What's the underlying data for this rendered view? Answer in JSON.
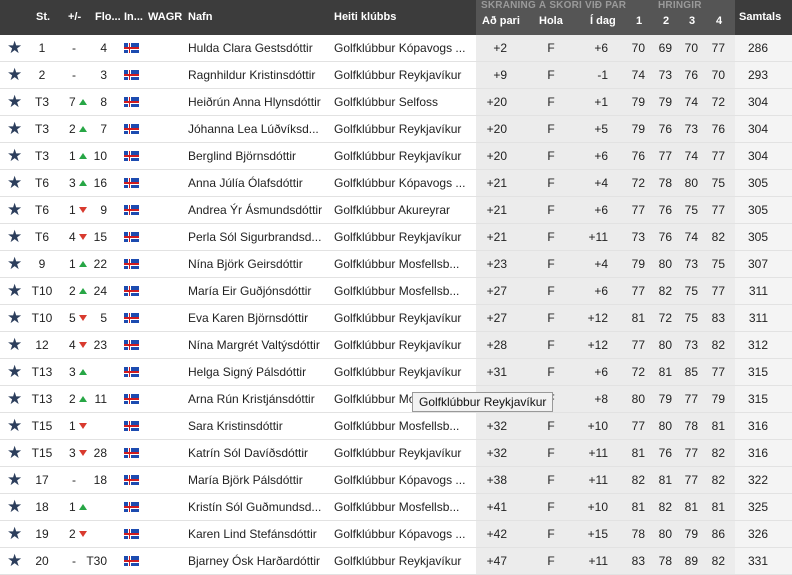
{
  "header": {
    "st": "St.",
    "plusminus": "+/-",
    "flo": "Flo...",
    "in": "In...",
    "wagr": "WAGR",
    "name": "Nafn",
    "club": "Heiti klúbbs",
    "scoring_group": "SKRÁNING Á SKORI VIÐ PAR",
    "par": "Að pari",
    "hole": "Hola",
    "today": "Í dag",
    "rounds_group": "HRINGIR",
    "r1": "1",
    "r2": "2",
    "r3": "3",
    "r4": "4",
    "total": "Samtals"
  },
  "rows": [
    {
      "st": "1",
      "pm": "-",
      "dir": "",
      "flo": "4",
      "name": "Hulda Clara Gestsdóttir",
      "club": "Golfklúbbur Kópavogs ...",
      "par": "+2",
      "hole": "F",
      "today": "+6",
      "r1": "70",
      "r2": "69",
      "r3": "70",
      "r4": "77",
      "total": "286"
    },
    {
      "st": "2",
      "pm": "-",
      "dir": "",
      "flo": "3",
      "name": "Ragnhildur Kristinsdóttir",
      "club": "Golfklúbbur Reykjavíkur",
      "par": "+9",
      "hole": "F",
      "today": "-1",
      "r1": "74",
      "r2": "73",
      "r3": "76",
      "r4": "70",
      "total": "293"
    },
    {
      "st": "T3",
      "pm": "7",
      "dir": "up",
      "flo": "8",
      "name": "Heiðrún Anna Hlynsdóttir",
      "club": "Golfklúbbur Selfoss",
      "par": "+20",
      "hole": "F",
      "today": "+1",
      "r1": "79",
      "r2": "79",
      "r3": "74",
      "r4": "72",
      "total": "304"
    },
    {
      "st": "T3",
      "pm": "2",
      "dir": "up",
      "flo": "7",
      "name": "Jóhanna Lea Lúðvíksd...",
      "club": "Golfklúbbur Reykjavíkur",
      "par": "+20",
      "hole": "F",
      "today": "+5",
      "r1": "79",
      "r2": "76",
      "r3": "73",
      "r4": "76",
      "total": "304"
    },
    {
      "st": "T3",
      "pm": "1",
      "dir": "up",
      "flo": "10",
      "name": "Berglind Björnsdóttir",
      "club": "Golfklúbbur Reykjavíkur",
      "par": "+20",
      "hole": "F",
      "today": "+6",
      "r1": "76",
      "r2": "77",
      "r3": "74",
      "r4": "77",
      "total": "304"
    },
    {
      "st": "T6",
      "pm": "3",
      "dir": "up",
      "flo": "16",
      "name": "Anna Júlía Ólafsdóttir",
      "club": "Golfklúbbur Kópavogs ...",
      "par": "+21",
      "hole": "F",
      "today": "+4",
      "r1": "72",
      "r2": "78",
      "r3": "80",
      "r4": "75",
      "total": "305"
    },
    {
      "st": "T6",
      "pm": "1",
      "dir": "down",
      "flo": "9",
      "name": "Andrea Ýr Ásmundsdóttir",
      "club": "Golfklúbbur Akureyrar",
      "par": "+21",
      "hole": "F",
      "today": "+6",
      "r1": "77",
      "r2": "76",
      "r3": "75",
      "r4": "77",
      "total": "305"
    },
    {
      "st": "T6",
      "pm": "4",
      "dir": "down",
      "flo": "15",
      "name": "Perla Sól Sigurbrandsd...",
      "club": "Golfklúbbur Reykjavíkur",
      "par": "+21",
      "hole": "F",
      "today": "+11",
      "r1": "73",
      "r2": "76",
      "r3": "74",
      "r4": "82",
      "total": "305"
    },
    {
      "st": "9",
      "pm": "1",
      "dir": "up",
      "flo": "22",
      "name": "Nína Björk Geirsdóttir",
      "club": "Golfklúbbur Mosfellsb...",
      "par": "+23",
      "hole": "F",
      "today": "+4",
      "r1": "79",
      "r2": "80",
      "r3": "73",
      "r4": "75",
      "total": "307"
    },
    {
      "st": "T10",
      "pm": "2",
      "dir": "up",
      "flo": "24",
      "name": "María Eir Guðjónsdóttir",
      "club": "Golfklúbbur Mosfellsb...",
      "par": "+27",
      "hole": "F",
      "today": "+6",
      "r1": "77",
      "r2": "82",
      "r3": "75",
      "r4": "77",
      "total": "311"
    },
    {
      "st": "T10",
      "pm": "5",
      "dir": "down",
      "flo": "5",
      "name": "Eva Karen Björnsdóttir",
      "club": "Golfklúbbur Reykjavíkur",
      "par": "+27",
      "hole": "F",
      "today": "+12",
      "r1": "81",
      "r2": "72",
      "r3": "75",
      "r4": "83",
      "total": "311"
    },
    {
      "st": "12",
      "pm": "4",
      "dir": "down",
      "flo": "23",
      "name": "Nína Margrét Valtýsdóttir",
      "club": "Golfklúbbur Reykjavíkur",
      "par": "+28",
      "hole": "F",
      "today": "+12",
      "r1": "77",
      "r2": "80",
      "r3": "73",
      "r4": "82",
      "total": "312"
    },
    {
      "st": "T13",
      "pm": "3",
      "dir": "up",
      "flo": "",
      "name": "Helga Signý Pálsdóttir",
      "club": "Golfklúbbur Reykjavíkur",
      "par": "+31",
      "hole": "F",
      "today": "+6",
      "r1": "72",
      "r2": "81",
      "r3": "85",
      "r4": "77",
      "total": "315"
    },
    {
      "st": "T13",
      "pm": "2",
      "dir": "up",
      "flo": "11",
      "name": "Arna Rún Kristjánsdóttir",
      "club": "Golfklúbbur Mosfellsb...",
      "par": "+31",
      "hole": "F",
      "today": "+8",
      "r1": "80",
      "r2": "79",
      "r3": "77",
      "r4": "79",
      "total": "315"
    },
    {
      "st": "T15",
      "pm": "1",
      "dir": "down",
      "flo": "",
      "name": "Sara Kristinsdóttir",
      "club": "Golfklúbbur Mosfellsb...",
      "par": "+32",
      "hole": "F",
      "today": "+10",
      "r1": "77",
      "r2": "80",
      "r3": "78",
      "r4": "81",
      "total": "316"
    },
    {
      "st": "T15",
      "pm": "3",
      "dir": "down",
      "flo": "28",
      "name": "Katrín Sól Davíðsdóttir",
      "club": "Golfklúbbur Reykjavíkur",
      "par": "+32",
      "hole": "F",
      "today": "+11",
      "r1": "81",
      "r2": "76",
      "r3": "77",
      "r4": "82",
      "total": "316"
    },
    {
      "st": "17",
      "pm": "-",
      "dir": "",
      "flo": "18",
      "name": "María Björk Pálsdóttir",
      "club": "Golfklúbbur Kópavogs ...",
      "par": "+38",
      "hole": "F",
      "today": "+11",
      "r1": "82",
      "r2": "81",
      "r3": "77",
      "r4": "82",
      "total": "322"
    },
    {
      "st": "18",
      "pm": "1",
      "dir": "up",
      "flo": "",
      "name": "Kristín Sól Guðmundsd...",
      "club": "Golfklúbbur Mosfellsb...",
      "par": "+41",
      "hole": "F",
      "today": "+10",
      "r1": "81",
      "r2": "82",
      "r3": "81",
      "r4": "81",
      "total": "325"
    },
    {
      "st": "19",
      "pm": "2",
      "dir": "down",
      "flo": "",
      "name": "Karen Lind Stefánsdóttir",
      "club": "Golfklúbbur Kópavogs ...",
      "par": "+42",
      "hole": "F",
      "today": "+15",
      "r1": "78",
      "r2": "80",
      "r3": "79",
      "r4": "86",
      "total": "326"
    },
    {
      "st": "20",
      "pm": "-",
      "dir": "",
      "flo": "T30",
      "name": "Bjarney Ósk Harðardóttir",
      "club": "Golfklúbbur Reykjavíkur",
      "par": "+47",
      "hole": "F",
      "today": "+11",
      "r1": "83",
      "r2": "78",
      "r3": "89",
      "r4": "82",
      "total": "331"
    }
  ],
  "tooltip": "Golfklúbbur Reykjavíkur",
  "colors": {
    "header_bg": "#3c3c3c",
    "score_bg": "#ececec",
    "star": "#2c3e5c",
    "up": "#27a645",
    "down": "#d83a2e"
  },
  "icons": {
    "favorite": "star-icon",
    "flag": "iceland-flag-icon",
    "up": "arrow-up-icon",
    "down": "arrow-down-icon"
  }
}
